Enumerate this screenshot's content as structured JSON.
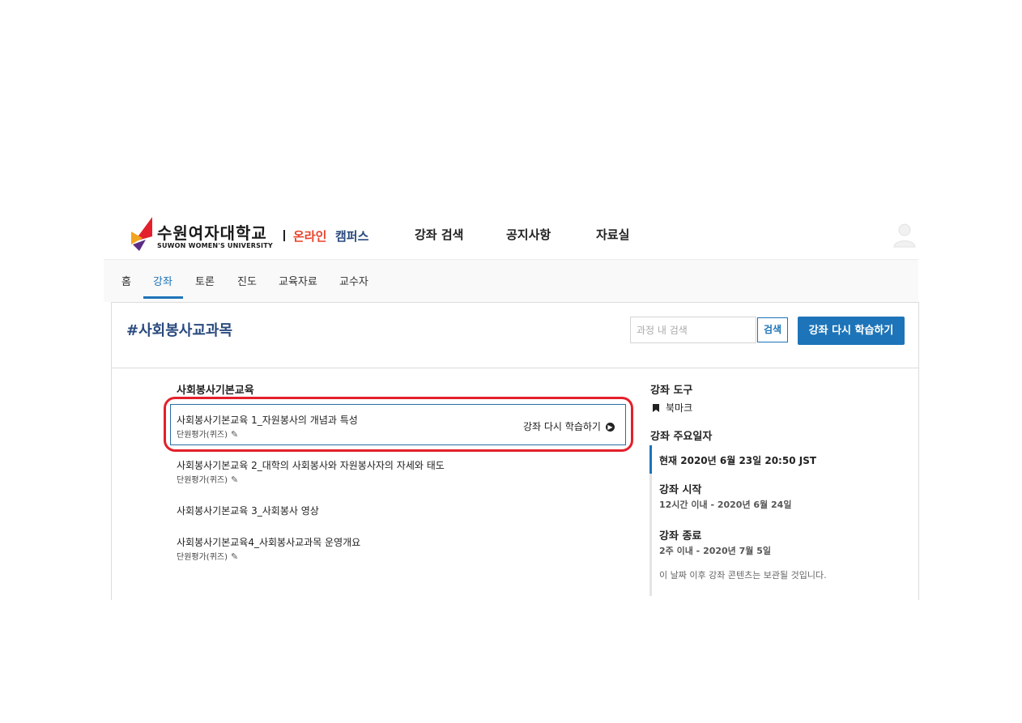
{
  "header": {
    "logo_kr": "수원여자대학교",
    "logo_en": "SUWON WOMEN'S UNIVERSITY",
    "brand_online": "온라인",
    "brand_campus": "캠퍼스",
    "nav": [
      "강좌 검색",
      "공지사항",
      "자료실"
    ]
  },
  "course_nav": {
    "items": [
      "홈",
      "강좌",
      "토론",
      "진도",
      "교육자료",
      "교수자"
    ],
    "active": "강좌"
  },
  "course": {
    "title": "#사회봉사교과목",
    "search_placeholder": "과정 내 검색",
    "search_button": "검색",
    "resume_button": "강좌 다시 학습하기"
  },
  "outline": {
    "section_title": "사회봉사기본교육",
    "units": [
      {
        "title": "사회봉사기본교육 1_자원봉사의 개념과 특성",
        "sub": "단원평가(퀴즈)",
        "action": "강좌 다시 학습하기"
      },
      {
        "title": "사회봉사기본교육 2_대학의 사회봉사와 자원봉사자의 자세와 태도",
        "sub": "단원평가(퀴즈)"
      },
      {
        "title": "사회봉사기본교육 3_사회봉사 영상",
        "sub": ""
      },
      {
        "title": "사회봉사기본교육4_사회봉사교과목 운영개요",
        "sub": "단원평가(퀴즈)"
      }
    ]
  },
  "sidebar": {
    "tools_heading": "강좌 도구",
    "bookmark": "북마크",
    "dates_heading": "강좌 주요일자",
    "current": "현재 2020년 6월 23일 20:50 JST",
    "start_heading": "강좌 시작",
    "start_date": "12시간 이내 - 2020년 6월 24일",
    "end_heading": "강좌 종료",
    "end_date": "2주 이내 - 2020년 7월 5일",
    "end_note": "이 날짜 이후 강좌 콘텐츠는 보관될 것입니다."
  },
  "colors": {
    "accent": "#1d74b8",
    "brand_red": "#e8432a",
    "highlight_red": "#e3202b",
    "title_navy": "#2a4a7e"
  }
}
